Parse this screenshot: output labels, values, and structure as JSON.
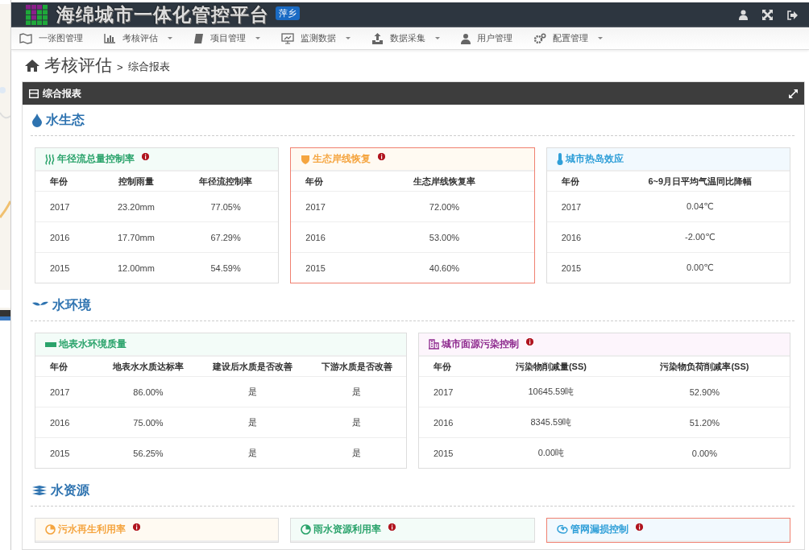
{
  "header": {
    "title": "海绵城市一体化管控平台",
    "badge": "萍乡"
  },
  "nav": [
    {
      "kind": "map",
      "label": "一张图管理",
      "dropdown": false
    },
    {
      "kind": "chart",
      "label": "考核评估",
      "dropdown": true
    },
    {
      "kind": "book",
      "label": "项目管理",
      "dropdown": true
    },
    {
      "kind": "monitor",
      "label": "监测数据",
      "dropdown": true
    },
    {
      "kind": "upload",
      "label": "数据采集",
      "dropdown": true
    },
    {
      "kind": "user",
      "label": "用户管理",
      "dropdown": false
    },
    {
      "kind": "gears",
      "label": "配置管理",
      "dropdown": true
    }
  ],
  "breadcrumb": {
    "title": "考核评估",
    "separator": ">",
    "current": "综合报表"
  },
  "panel": {
    "title": "综合报表"
  },
  "sections": [
    {
      "kind": "drop",
      "title": "水生态",
      "cards": [
        {
          "kind": "waves",
          "title": "年径流总量控制率",
          "info": true,
          "color": "#2aa36b",
          "highlighted": false,
          "columns": [
            "年份",
            "控制雨量",
            "年径流控制率"
          ],
          "rows": [
            [
              "2017",
              "23.20mm",
              "77.05%"
            ],
            [
              "2016",
              "17.70mm",
              "67.29%"
            ],
            [
              "2015",
              "12.00mm",
              "54.59%"
            ]
          ]
        },
        {
          "kind": "shield",
          "title": "生态岸线恢复",
          "info": true,
          "color": "#f5a540",
          "highlighted": true,
          "columns": [
            "年份",
            "生态岸线恢复率"
          ],
          "rows": [
            [
              "2017",
              "72.00%"
            ],
            [
              "2016",
              "53.00%"
            ],
            [
              "2015",
              "40.60%"
            ]
          ]
        },
        {
          "kind": "thermometer",
          "title": "城市热岛效应",
          "info": false,
          "color": "#2f9fd8",
          "highlighted": false,
          "columns": [
            "年份",
            "6~9月日平均气温同比降幅"
          ],
          "rows": [
            [
              "2017",
              "0.04℃"
            ],
            [
              "2016",
              "-2.00℃"
            ],
            [
              "2015",
              "0.00℃"
            ]
          ]
        }
      ]
    },
    {
      "kind": "sprout",
      "title": "水环境",
      "cards": [
        {
          "kind": "bar",
          "title": "地表水环境质量",
          "info": false,
          "color": "#2aa36b",
          "highlighted": false,
          "columns": [
            "年份",
            "地表水水质达标率",
            "建设后水质是否改善",
            "下游水质是否改善"
          ],
          "rows": [
            [
              "2017",
              "86.00%",
              "是",
              "是"
            ],
            [
              "2016",
              "75.00%",
              "是",
              "是"
            ],
            [
              "2015",
              "56.25%",
              "是",
              "是"
            ]
          ]
        },
        {
          "kind": "building",
          "title": "城市面源污染控制",
          "info": true,
          "color": "#8e2a8e",
          "highlighted": false,
          "columns": [
            "年份",
            "污染物削减量(SS)",
            "污染物负荷削减率(SS)"
          ],
          "rows": [
            [
              "2017",
              "10645.59吨",
              "52.90%"
            ],
            [
              "2016",
              "8345.59吨",
              "51.20%"
            ],
            [
              "2015",
              "0.00吨",
              "0.00%"
            ]
          ]
        }
      ]
    },
    {
      "kind": "layers",
      "title": "水资源",
      "cards": [
        {
          "kind": "pie",
          "title": "污水再生利用率",
          "info": true,
          "color": "#f5a540",
          "highlighted": false
        },
        {
          "kind": "pie",
          "title": "雨水资源利用率",
          "info": true,
          "color": "#2aa36b",
          "highlighted": false
        },
        {
          "kind": "spiral",
          "title": "管网漏损控制",
          "info": true,
          "color": "#2f9fd8",
          "highlighted": true
        }
      ]
    }
  ]
}
